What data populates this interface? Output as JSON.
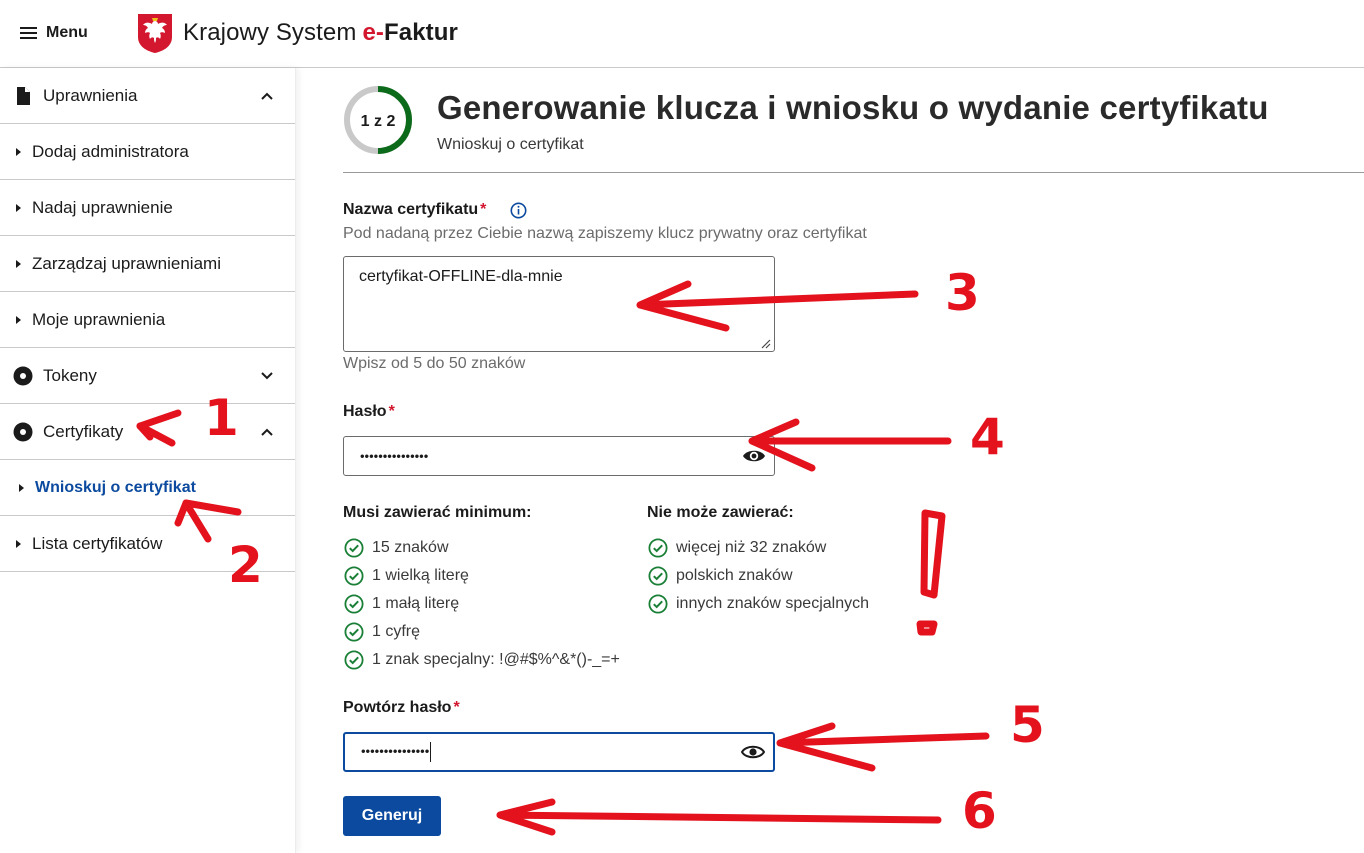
{
  "header": {
    "menu_label": "Menu",
    "brand_prefix": "Krajowy System",
    "brand_e": "e-",
    "brand_suffix": "Faktur"
  },
  "sidebar": {
    "items": [
      {
        "label": "Uprawnienia",
        "icon": "document-icon",
        "chevron": "up"
      },
      {
        "label": "Dodaj administratora"
      },
      {
        "label": "Nadaj uprawnienie"
      },
      {
        "label": "Zarządzaj uprawnieniami"
      },
      {
        "label": "Moje uprawnienia"
      },
      {
        "label": "Tokeny",
        "icon": "disc-icon",
        "chevron": "down"
      },
      {
        "label": "Certyfikaty",
        "icon": "disc-icon",
        "chevron": "up"
      },
      {
        "label": "Wnioskuj o certyfikat",
        "active": true
      },
      {
        "label": "Lista certyfikatów"
      }
    ]
  },
  "main": {
    "step_text": "1 z 2",
    "step_progress": 0.5,
    "title": "Generowanie klucza i wniosku o wydanie certyfikatu",
    "subtitle": "Wnioskuj o certyfikat",
    "cert_name": {
      "label": "Nazwa certyfikatu",
      "required_mark": "*",
      "hint": "Pod nadaną przez Ciebie nazwą zapiszemy klucz prywatny oraz certyfikat",
      "value": "certyfikat-OFFLINE-dla-mnie",
      "length_hint": "Wpisz od 5 do 50 znaków"
    },
    "password": {
      "label": "Hasło",
      "required_mark": "*",
      "masked_value": "•••••••••••••••"
    },
    "rules": {
      "must_heading": "Musi zawierać minimum:",
      "must": [
        "15 znaków",
        "1 wielką literę",
        "1 małą literę",
        "1 cyfrę",
        "1 znak specjalny: !@#$%^&*()-_=+"
      ],
      "mustnot_heading": "Nie może zawierać:",
      "mustnot": [
        "więcej niż 32 znaków",
        "polskich znaków",
        "innych znaków specjalnych"
      ]
    },
    "repeat_password": {
      "label": "Powtórz hasło",
      "required_mark": "*",
      "masked_value": "•••••••••••••••"
    },
    "generate_button": "Generuj"
  },
  "annotations": {
    "numbers": [
      "1",
      "2",
      "3",
      "4",
      "5",
      "6"
    ],
    "exclamation": "!"
  },
  "colors": {
    "primary": "#0b4a9e",
    "required": "#d3172e",
    "success": "#1a7f37",
    "progress": "#0c6b1a",
    "annotation": "#e3121d"
  }
}
